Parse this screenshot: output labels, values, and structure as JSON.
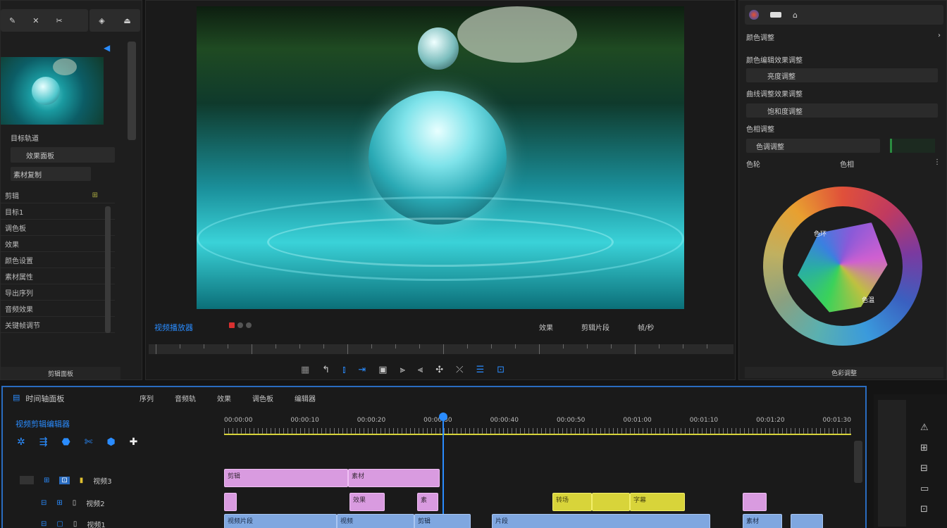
{
  "left_panel": {
    "top_tools": [
      "✎",
      "✕",
      "✂",
      "◈",
      "⏏"
    ],
    "list_items": [
      "剪辑",
      "目标1",
      "调色板",
      "效果",
      "颜色设置",
      "素材属性",
      "导出序列",
      "音频效果",
      "关键帧调节"
    ],
    "prop_rows": [
      "目标轨道",
      "效果面板",
      "素材复制"
    ],
    "footer": "剪辑面板"
  },
  "viewer": {
    "title": "视频播放器",
    "right_labels": [
      "效果",
      "剪辑片段",
      "帧/秒"
    ],
    "transport": [
      "▦",
      "↰",
      "⫾",
      "⇥",
      "▣",
      "⫸",
      "⫷",
      "✣",
      "⤫",
      "☰",
      "⊡"
    ]
  },
  "right_panel": {
    "header": "颜色调整",
    "section1": "颜色编辑效果调整",
    "field1": "亮度调整",
    "section2": "曲线调整效果调整",
    "field2": "饱和度调整",
    "section3": "色相调整",
    "field3": "色调调整",
    "wheel_label_left": "色环",
    "wheel_label_right": "色温",
    "wheel_header_left": "色轮",
    "wheel_header_mid": "色相",
    "footer": "色彩调整",
    "colors": {
      "accent": "#2a8cff",
      "wheel_red": "#e0503a",
      "wheel_orange": "#e8a030"
    }
  },
  "timeline": {
    "title": "时间轴面板",
    "tabs": [
      "序列",
      "音频轨",
      "效果",
      "调色板",
      "编辑器"
    ],
    "subtitle": "视频剪辑编辑器",
    "timecodes": [
      "00:00:00",
      "00:00:10",
      "00:00:20",
      "00:00:30",
      "00:00:40",
      "00:00:50",
      "00:01:00",
      "00:01:10",
      "00:01:20",
      "00:01:30"
    ],
    "tracks": [
      {
        "label": "视频3",
        "clips": [
          {
            "text": "剪辑",
            "color": "pink"
          },
          {
            "text": "素材",
            "color": "pink"
          }
        ]
      },
      {
        "label": "视频2",
        "clips": [
          {
            "text": "",
            "color": "pink"
          },
          {
            "text": "效果",
            "color": "pink"
          },
          {
            "text": "素",
            "color": "pink"
          },
          {
            "text": "转场",
            "color": "yellow"
          },
          {
            "text": "",
            "color": "yellow"
          },
          {
            "text": "字幕",
            "color": "yellow"
          },
          {
            "text": "",
            "color": "pink"
          }
        ]
      },
      {
        "label": "视频1",
        "clips": [
          {
            "text": "视频片段",
            "color": "blue"
          },
          {
            "text": "视频",
            "color": "blue"
          },
          {
            "text": "剪辑",
            "color": "blue"
          },
          {
            "text": "片段",
            "color": "blue"
          },
          {
            "text": "素材",
            "color": "blue"
          }
        ]
      }
    ],
    "right_icons": [
      "⚠",
      "⊞",
      "⊟",
      "▭",
      "⊡"
    ]
  }
}
